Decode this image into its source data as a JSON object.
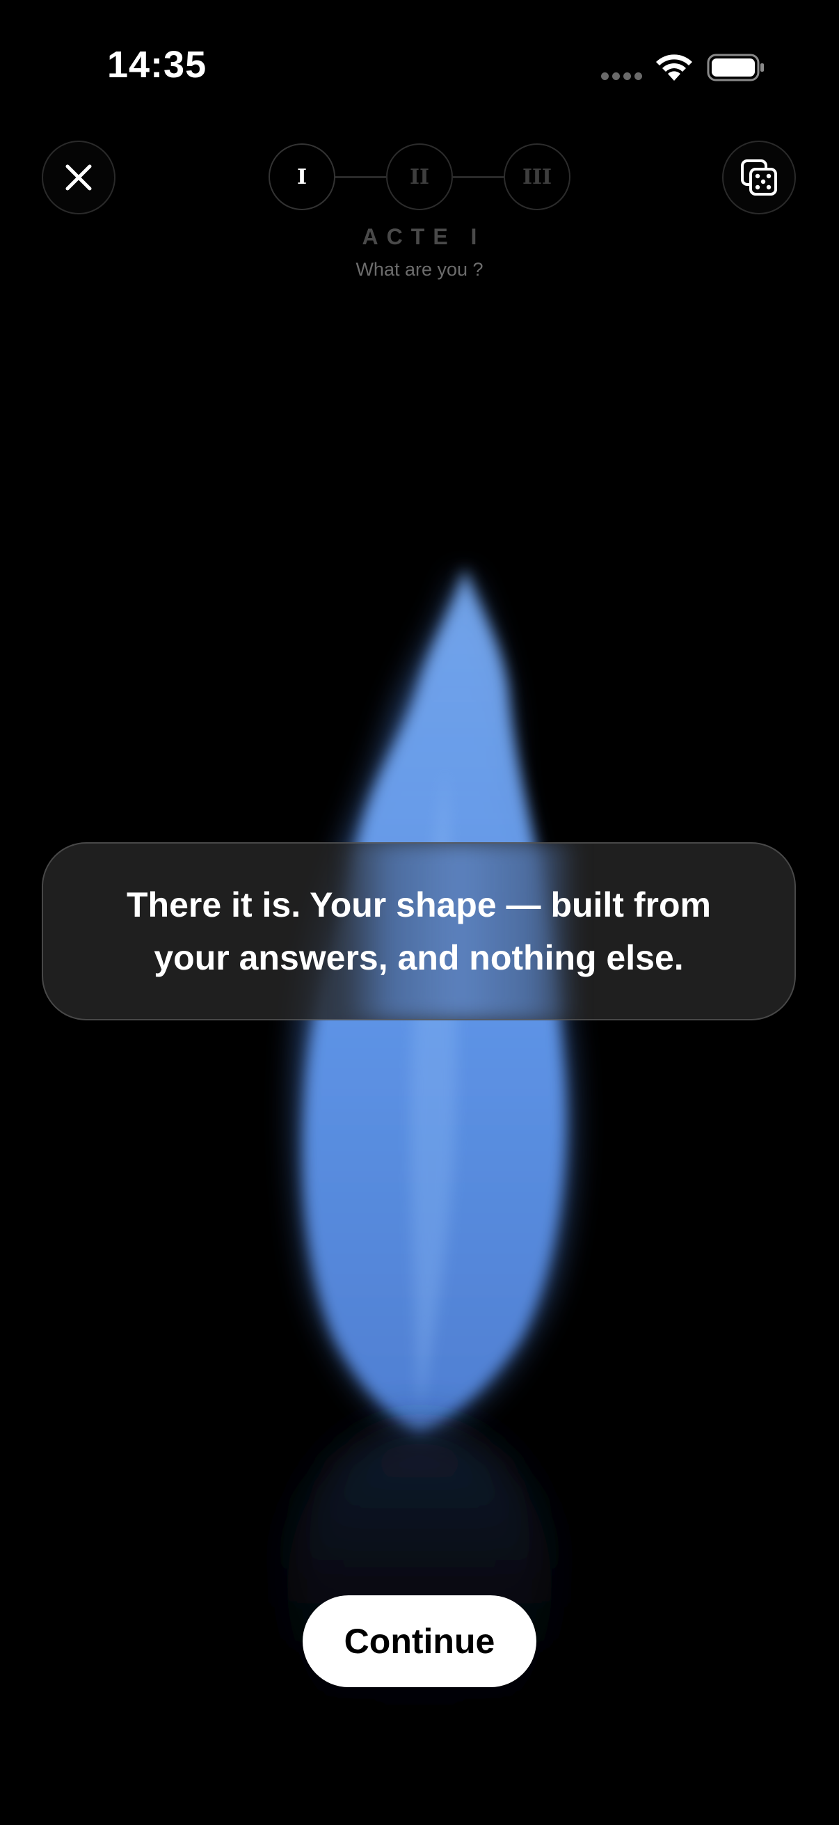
{
  "status_bar": {
    "time": "14:35"
  },
  "header": {
    "close_icon": "close-icon",
    "shuffle_icon": "dice-icon",
    "steps": [
      {
        "label": "I",
        "active": true
      },
      {
        "label": "II",
        "active": false
      },
      {
        "label": "III",
        "active": false
      }
    ],
    "act_title": "ACTE I",
    "act_subtitle": "What are you ?"
  },
  "visual": {
    "flame_color": "#6aa3f0"
  },
  "message": {
    "text": "There it is. Your shape — built from your answers, and nothing else."
  },
  "actions": {
    "continue_label": "Continue"
  }
}
